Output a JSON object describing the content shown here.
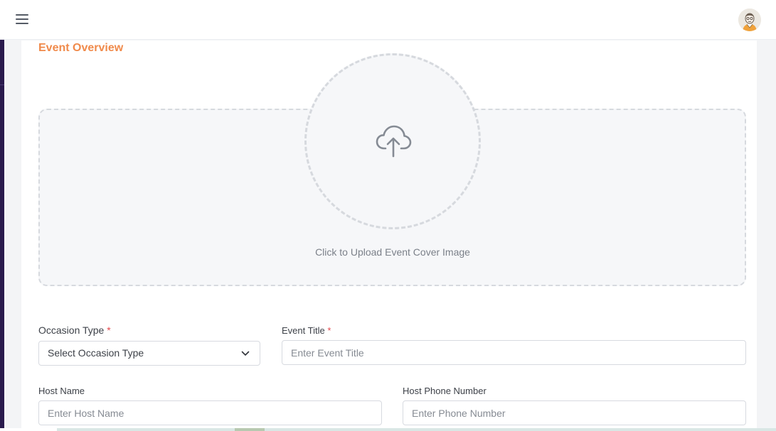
{
  "header": {
    "menu_icon": "hamburger-menu-icon",
    "avatar_icon": "user-avatar"
  },
  "section": {
    "title": "Event Overview"
  },
  "upload": {
    "icon": "cloud-upload-icon",
    "text": "Click to Upload Event Cover Image"
  },
  "form": {
    "occasion_type": {
      "label": "Occasion Type",
      "required_mark": "*",
      "value": "Select Occasion Type"
    },
    "event_title": {
      "label": "Event Title",
      "required_mark": "*",
      "placeholder": "Enter Event Title"
    },
    "host_name": {
      "label": "Host Name",
      "placeholder": "Enter Host Name"
    },
    "host_phone": {
      "label": "Host Phone Number",
      "placeholder": "Enter Phone Number"
    }
  },
  "colors": {
    "accent": "#f08a4b",
    "required": "#e5484d",
    "sidebar": "#2a1a4d"
  }
}
